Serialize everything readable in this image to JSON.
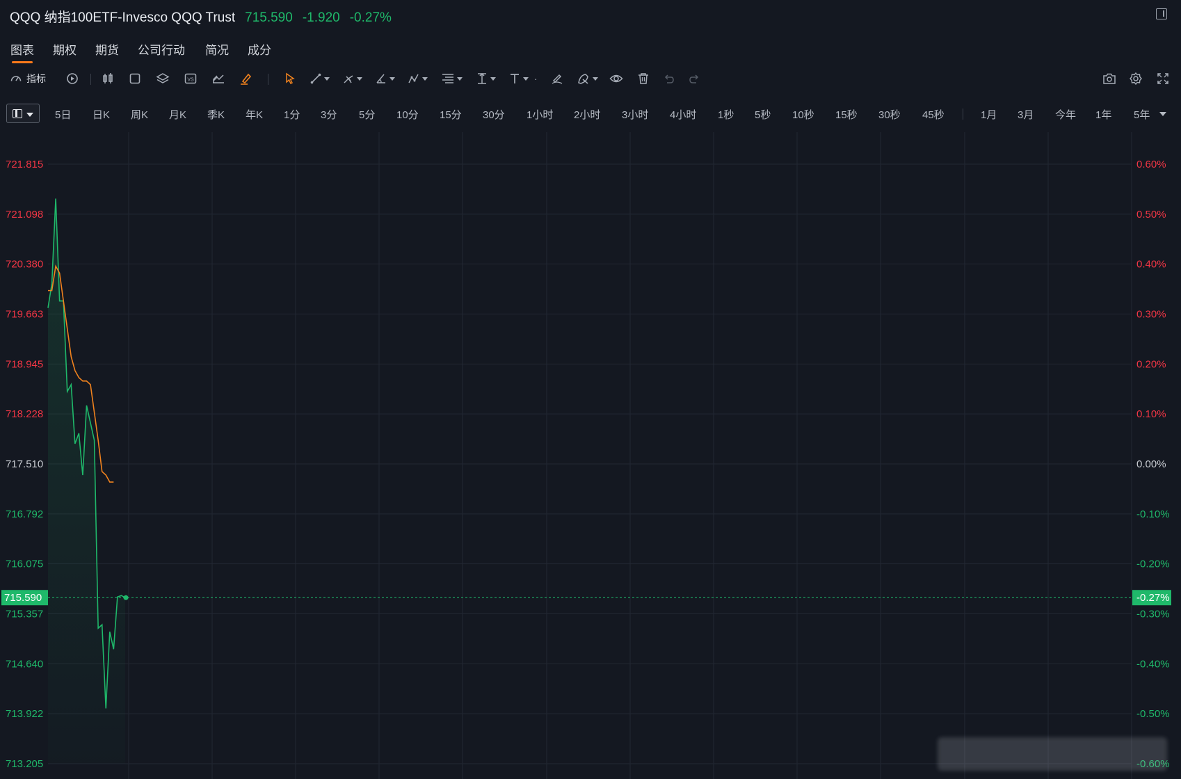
{
  "header": {
    "symbol_name": "QQQ 纳指100ETF-Invesco QQQ Trust",
    "price": "715.590",
    "change": "-1.920",
    "change_pct": "-0.27%"
  },
  "tabs": [
    {
      "label": "图表",
      "active": true
    },
    {
      "label": "期权"
    },
    {
      "label": "期货"
    },
    {
      "label": "公司行动"
    },
    {
      "label": "简况"
    },
    {
      "label": "成分"
    }
  ],
  "toolbar": {
    "indicator_label": "指标",
    "icons": [
      "speedometer-icon",
      "replay-icon",
      "candlestick-icon",
      "square-icon",
      "layers-icon",
      "vs-icon",
      "chart-compare-icon",
      "brush-icon",
      "cursor-icon",
      "trendline-icon",
      "pitchfork-icon",
      "angle-icon",
      "pattern-icon",
      "fib-icon",
      "measure-icon",
      "text-icon",
      "pen-icon",
      "magnet-icon",
      "eye-icon",
      "trash-icon",
      "undo-icon",
      "redo-icon",
      "camera-icon",
      "gear-icon",
      "fullscreen-icon"
    ]
  },
  "periods": [
    "5日",
    "日K",
    "周K",
    "月K",
    "季K",
    "年K",
    "1分",
    "3分",
    "5分",
    "10分",
    "15分",
    "30分",
    "1小时",
    "2小时",
    "3小时",
    "4小时",
    "1秒",
    "5秒",
    "10秒",
    "15秒",
    "30秒",
    "45秒",
    "1月",
    "3月",
    "今年",
    "1年",
    "5年"
  ],
  "colors": {
    "up": "#f23645",
    "down": "#1fb86a",
    "neutral": "#c9ccd2",
    "avg_line": "#f0821e",
    "background": "#141821"
  },
  "chart_data": {
    "type": "line",
    "y_left_ticks": [
      "721.815",
      "721.098",
      "720.380",
      "719.663",
      "718.945",
      "718.228",
      "717.510",
      "716.792",
      "716.075",
      "715.357",
      "714.640",
      "713.922",
      "713.205"
    ],
    "y_right_ticks": [
      "0.60%",
      "0.50%",
      "0.40%",
      "0.30%",
      "0.20%",
      "0.10%",
      "0.00%",
      "-0.10%",
      "-0.20%",
      "-0.30%",
      "-0.40%",
      "-0.50%",
      "-0.60%"
    ],
    "ylim": [
      713.205,
      721.815
    ],
    "prev_close": 717.51,
    "current_price": "715.590",
    "current_pct": "-0.27%",
    "series": [
      {
        "values": [
          719.75,
          720.1,
          721.32,
          719.85,
          719.85,
          718.55,
          718.65,
          717.8,
          717.95,
          717.35,
          718.35,
          718.1,
          717.85,
          715.15,
          715.2,
          714.0,
          715.1,
          714.85,
          715.6,
          715.62,
          715.59
        ]
      },
      {
        "values": [
          720.0,
          720.0,
          720.35,
          720.25,
          719.85,
          719.45,
          719.05,
          718.85,
          718.75,
          718.7,
          718.7,
          718.65,
          718.25,
          717.85,
          717.4,
          717.35,
          717.25,
          717.25
        ]
      }
    ]
  }
}
